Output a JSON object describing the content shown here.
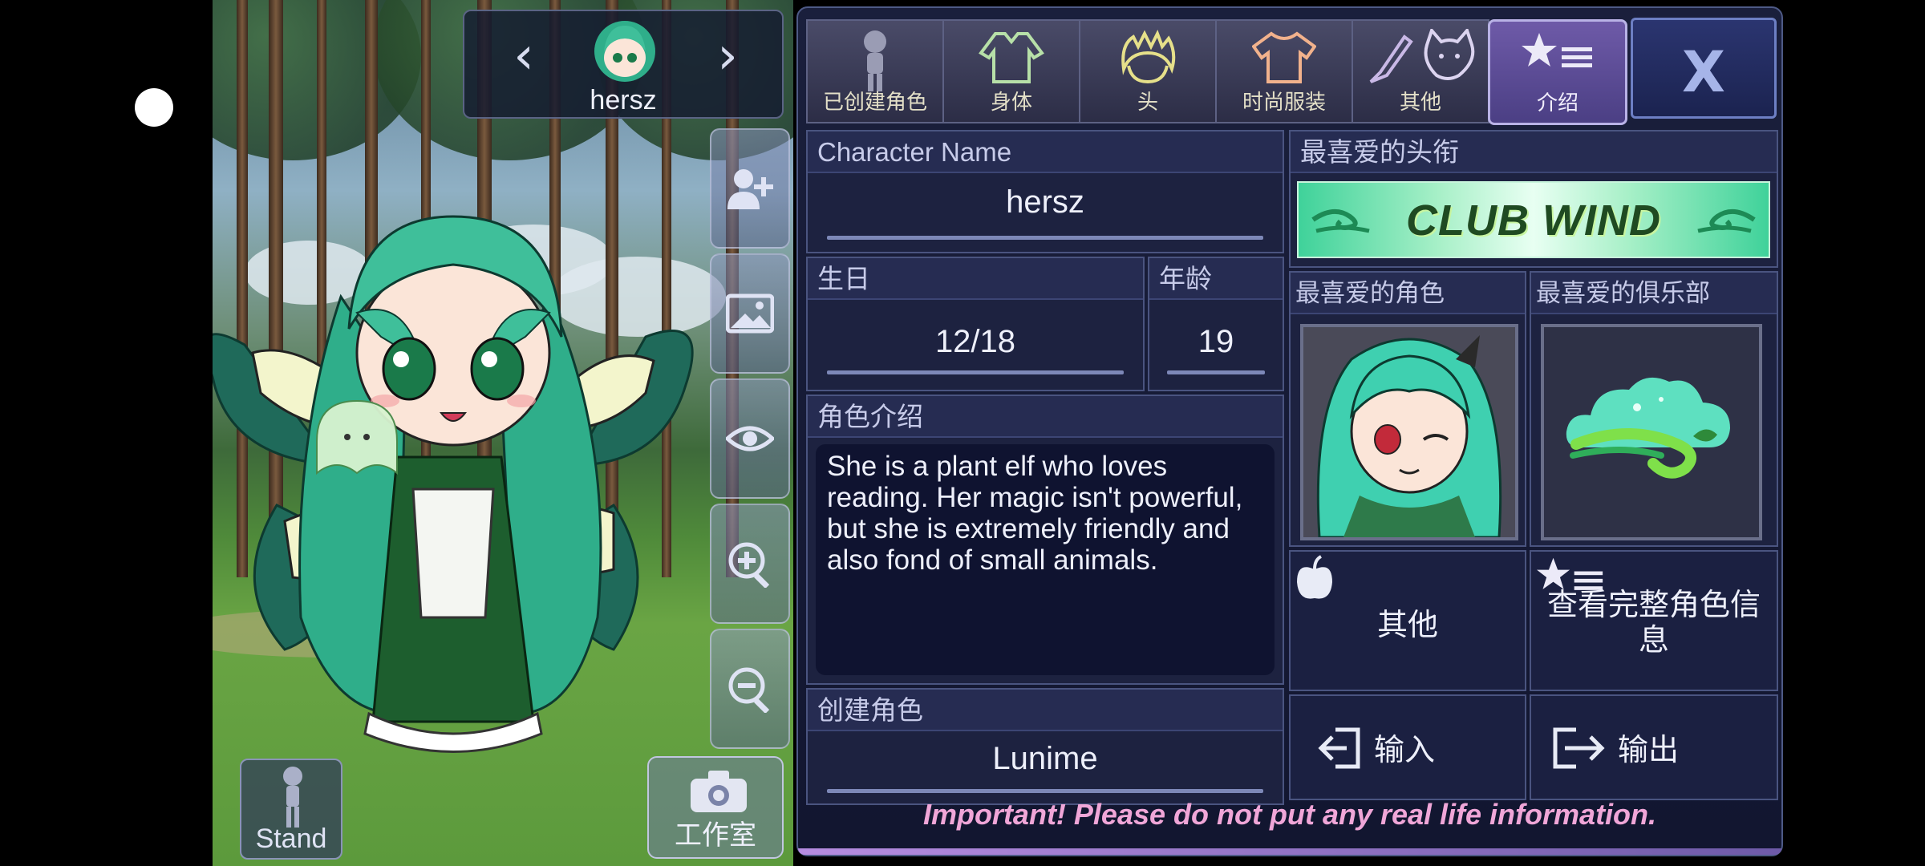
{
  "character": {
    "name": "hersz"
  },
  "tabs": [
    {
      "label": "已创建角色",
      "icon": "person-icon"
    },
    {
      "label": "身体",
      "icon": "jacket-icon"
    },
    {
      "label": "头",
      "icon": "hair-icon"
    },
    {
      "label": "时尚服装",
      "icon": "shirt-icon"
    },
    {
      "label": "其他",
      "icon": "sword-cat-icon"
    },
    {
      "label": "介绍",
      "icon": "star-list-icon"
    }
  ],
  "close_label": "X",
  "fields": {
    "character_name": {
      "label": "Character Name",
      "value": "hersz"
    },
    "birthday": {
      "label": "生日",
      "value": "12/18"
    },
    "age": {
      "label": "年龄",
      "value": "19"
    },
    "bio": {
      "label": "角色介绍",
      "value": "She is a plant elf who loves reading. Her magic isn't powerful, but she is extremely friendly and also fond of small animals."
    },
    "creator": {
      "label": "创建角色",
      "value": "Lunime"
    }
  },
  "favorites": {
    "title_label": "最喜爱的头衔",
    "title_banner": "CLUB WIND",
    "character_label": "最喜爱的角色",
    "club_label": "最喜爱的俱乐部"
  },
  "buttons": {
    "other": "其他",
    "view_full": "查看完整角色信息",
    "import": "输入",
    "export": "输出"
  },
  "bottom": {
    "stand": "Stand",
    "studio": "工作室"
  },
  "warning": "Important! Please do not put any real life information.",
  "colors": {
    "accent": "#6e5aa8",
    "warning": "#f0a6d8",
    "hair": "#3fbf9a"
  }
}
